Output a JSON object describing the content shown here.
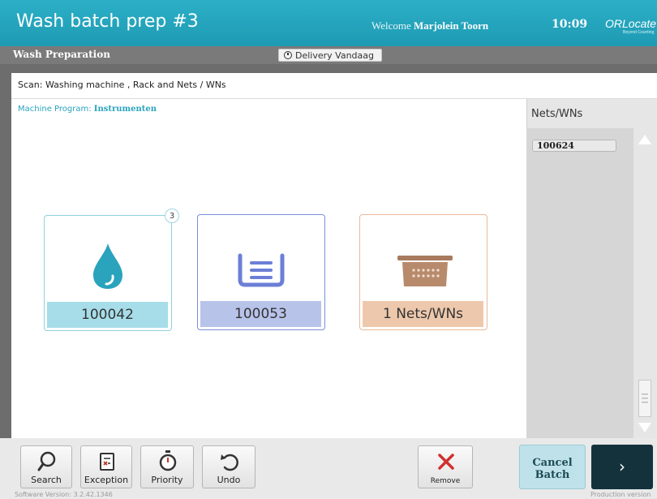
{
  "header": {
    "title": "Wash batch prep #3",
    "welcome_label": "Welcome",
    "user": "Marjolein Toorn",
    "time": "10:09",
    "logo": "ORLocate",
    "logo_tagline": "Beyond Counting"
  },
  "subheader": {
    "title": "Wash Preparation",
    "delivery_label": "Delivery Vandaag"
  },
  "scan": {
    "instruction": "Scan: Washing machine , Rack and Nets / WNs",
    "program_label": "Machine Program:",
    "program_value": "Instrumenten"
  },
  "cards": {
    "machine": {
      "label": "100042",
      "badge": "3",
      "icon": "water-drop-icon",
      "color": "#2aa3bd"
    },
    "rack": {
      "label": "100053",
      "icon": "rack-icon",
      "color": "#5d6fcf"
    },
    "nets": {
      "label": "1 Nets/WNs",
      "icon": "basket-icon",
      "color": "#a87a5e"
    }
  },
  "nets_panel": {
    "header": "Nets/WNs",
    "items": [
      "100624"
    ]
  },
  "toolbar": {
    "search": "Search",
    "exception": "Exception",
    "priority": "Priority",
    "undo": "Undo",
    "remove": "Remove",
    "cancel_line1": "Cancel",
    "cancel_line2": "Batch",
    "next": "›"
  },
  "footer": {
    "version": "Software Version: 3.2.42.1346",
    "environment": "Production version"
  }
}
